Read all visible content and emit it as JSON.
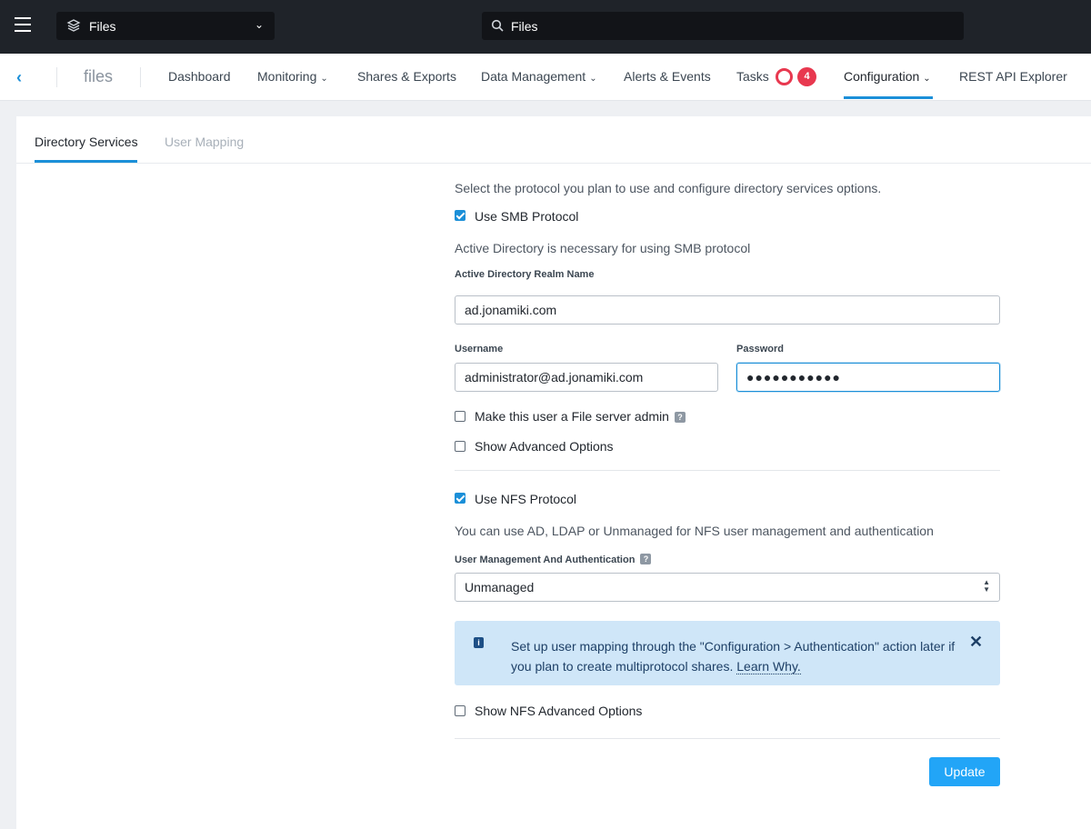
{
  "topbar": {
    "app_selector": "Files",
    "search_value": "Files"
  },
  "nav": {
    "app_name": "files",
    "items": {
      "dashboard": "Dashboard",
      "monitoring": "Monitoring",
      "shares": "Shares & Exports",
      "data_management": "Data Management",
      "alerts": "Alerts & Events",
      "tasks": "Tasks",
      "configuration": "Configuration",
      "rest_api": "REST API Explorer"
    },
    "tasks_count": "4",
    "active_item": "Configuration"
  },
  "tabs": {
    "directory_services": "Directory Services",
    "user_mapping": "User Mapping"
  },
  "form": {
    "intro": "Select the protocol you plan to use and configure directory services options.",
    "smb": {
      "checkbox_label": "Use SMB Protocol",
      "checked": true,
      "note": "Active Directory is necessary for using SMB protocol",
      "realm_label": "Active Directory Realm Name",
      "realm_value": "ad.jonamiki.com",
      "username_label": "Username",
      "username_value": "administrator@ad.jonamiki.com",
      "password_label": "Password",
      "password_value": "●●●●●●●●●●●",
      "admin_checkbox_label": "Make this user a File server admin",
      "admin_checked": false,
      "advanced_label": "Show Advanced Options",
      "advanced_checked": false
    },
    "nfs": {
      "checkbox_label": "Use NFS Protocol",
      "checked": true,
      "note": "You can use AD, LDAP or Unmanaged for NFS user management and authentication",
      "auth_label": "User Management And Authentication",
      "auth_value": "Unmanaged",
      "info_text": "Set up user mapping through the \"Configuration > Authentication\" action later if you plan to create multiprotocol shares.",
      "info_link": "Learn Why.",
      "advanced_label": "Show NFS Advanced Options",
      "advanced_checked": false
    },
    "update_button": "Update"
  },
  "colors": {
    "accent": "#1b8fd8",
    "topbar": "#1f2329",
    "badge": "#e8384f",
    "info_bg": "#cfe6f8",
    "button": "#22a5f7"
  },
  "icons": {
    "menu": "hamburger-icon",
    "app": "cube-icon",
    "search": "search-icon",
    "back": "chevron-left-icon",
    "help": "help-icon",
    "info": "info-icon",
    "close": "close-icon"
  }
}
